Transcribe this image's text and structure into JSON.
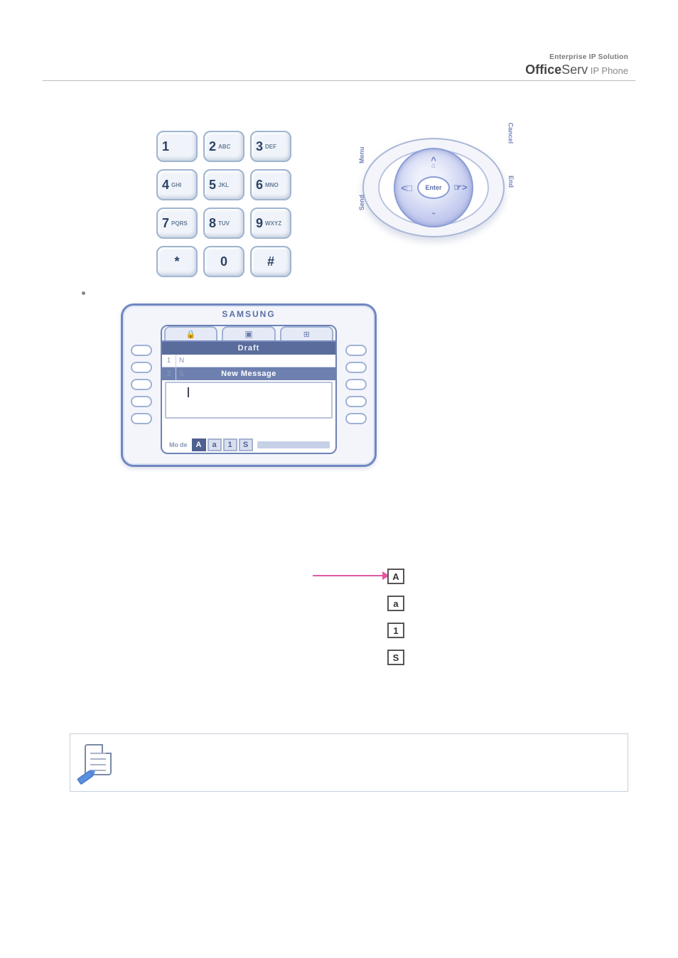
{
  "header": {
    "brand_top": "Enterprise IP Solution",
    "brand_bold": "Office",
    "brand_rest": "Serv",
    "brand_ip": " IP Phone"
  },
  "keypad": {
    "keys": [
      {
        "big": "1",
        "sub": ""
      },
      {
        "big": "2",
        "sub": "ABC"
      },
      {
        "big": "3",
        "sub": "DEF"
      },
      {
        "big": "4",
        "sub": "GHI"
      },
      {
        "big": "5",
        "sub": "JKL"
      },
      {
        "big": "6",
        "sub": "MNO"
      },
      {
        "big": "7",
        "sub": "PQRS"
      },
      {
        "big": "8",
        "sub": "TUV"
      },
      {
        "big": "9",
        "sub": "WXYZ"
      },
      {
        "big": "*",
        "sub": ""
      },
      {
        "big": "0",
        "sub": ""
      },
      {
        "big": "#",
        "sub": ""
      }
    ]
  },
  "nav": {
    "enter": "Enter",
    "menu": "Menu",
    "send": "Send",
    "cancel": "Cancel",
    "end": "End"
  },
  "lcd": {
    "brand": "SAMSUNG",
    "title": "Draft",
    "rows": [
      {
        "idx": "1",
        "txt": "N"
      },
      {
        "idx": "2",
        "txt": "S"
      }
    ],
    "msg": "New Message",
    "mode_label": "Mo",
    "mode_prefix": "de",
    "modes": [
      "A",
      "a",
      "1",
      "S"
    ],
    "active_mode": "A"
  },
  "modekeys": {
    "A": "A",
    "a": "a",
    "one": "1",
    "S": "S"
  }
}
